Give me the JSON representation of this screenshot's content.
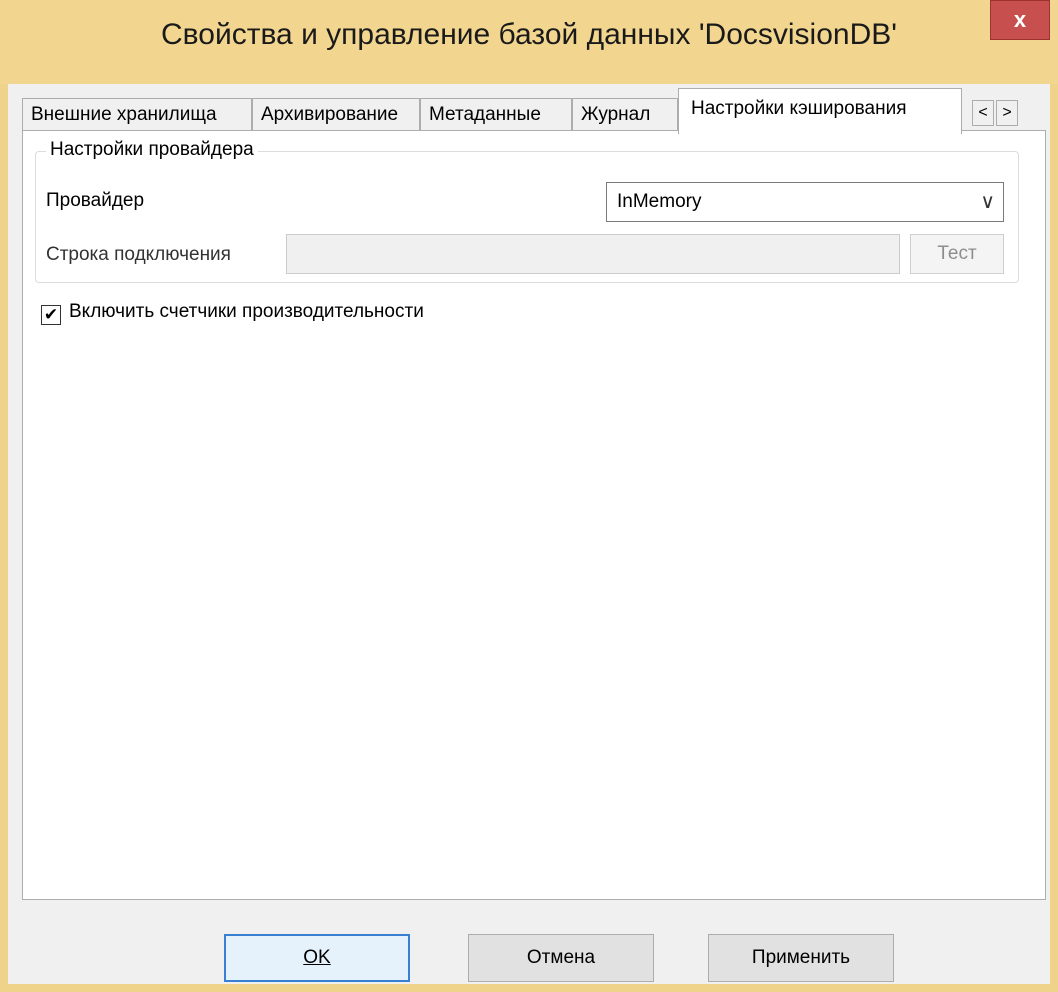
{
  "window": {
    "title": "Свойства и управление базой данных 'DocsvisionDB'",
    "close_label": "x"
  },
  "tabs": [
    {
      "label": "Внешние хранилища"
    },
    {
      "label": "Архивирование"
    },
    {
      "label": "Метаданные"
    },
    {
      "label": "Журнал"
    },
    {
      "label": "Настройки кэширования",
      "active": true
    }
  ],
  "tab_scroll": {
    "left": "<",
    "right": ">"
  },
  "provider_group": {
    "legend": "Настройки провайдера",
    "provider_label": "Провайдер",
    "provider_value": "InMemory",
    "connection_label": "Строка подключения",
    "connection_value": "",
    "test_button": "Тест"
  },
  "perf_counters": {
    "label": "Включить счетчики производительности",
    "checked": true
  },
  "footer": {
    "ok": "OK",
    "cancel": "Отмена",
    "apply": "Применить"
  },
  "colors": {
    "title_bar": "#f2d690",
    "close_button": "#c7504e",
    "default_button_border": "#3a80d2"
  }
}
